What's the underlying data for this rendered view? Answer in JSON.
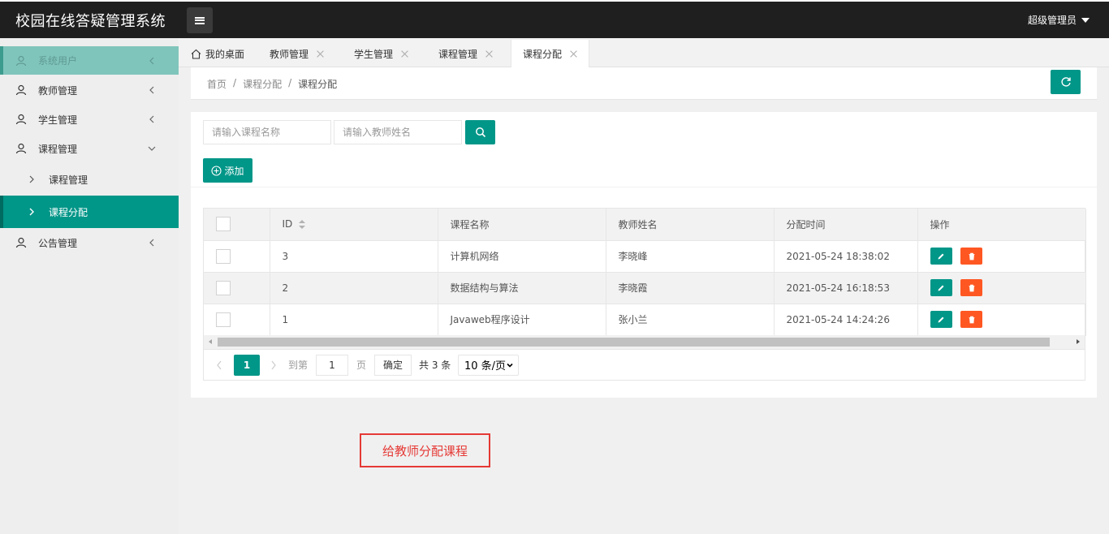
{
  "header": {
    "app_title": "校园在线答疑管理系统",
    "user_name": "超级管理员"
  },
  "sidebar": {
    "items": [
      {
        "label": "系统用户"
      },
      {
        "label": "教师管理"
      },
      {
        "label": "学生管理"
      },
      {
        "label": "课程管理"
      },
      {
        "label": "课程管理"
      },
      {
        "label": "课程分配"
      },
      {
        "label": "公告管理"
      }
    ]
  },
  "tabs": [
    {
      "label": "我的桌面"
    },
    {
      "label": "教师管理"
    },
    {
      "label": "学生管理"
    },
    {
      "label": "课程管理"
    },
    {
      "label": "课程分配"
    }
  ],
  "breadcrumb": {
    "home": "首页",
    "sep": "/",
    "parent": "课程分配",
    "current": "课程分配"
  },
  "search": {
    "course_placeholder": "请输入课程名称",
    "teacher_placeholder": "请输入教师姓名"
  },
  "toolbar": {
    "add_label": "添加"
  },
  "table": {
    "headers": [
      "ID",
      "课程名称",
      "教师姓名",
      "分配时间",
      "操作"
    ],
    "rows": [
      {
        "id": "3",
        "course": "计算机网络",
        "teacher": "李晓峰",
        "time": "2021-05-24 18:38:02"
      },
      {
        "id": "2",
        "course": "数据结构与算法",
        "teacher": "李晓霞",
        "time": "2021-05-24 16:18:53"
      },
      {
        "id": "1",
        "course": "Javaweb程序设计",
        "teacher": "张小兰",
        "time": "2021-05-24 14:24:26"
      }
    ]
  },
  "pagination": {
    "current_page": "1",
    "goto_label": "到第",
    "goto_value": "1",
    "page_unit": "页",
    "confirm_label": "确定",
    "total_label": "共 3 条",
    "limit_label": "10 条/页"
  },
  "annotation": {
    "text": "给教师分配课程"
  },
  "colors": {
    "accent": "#009688",
    "danger": "#ff5722",
    "header_bg": "#1f1f1f",
    "annotation": "#e53935"
  }
}
